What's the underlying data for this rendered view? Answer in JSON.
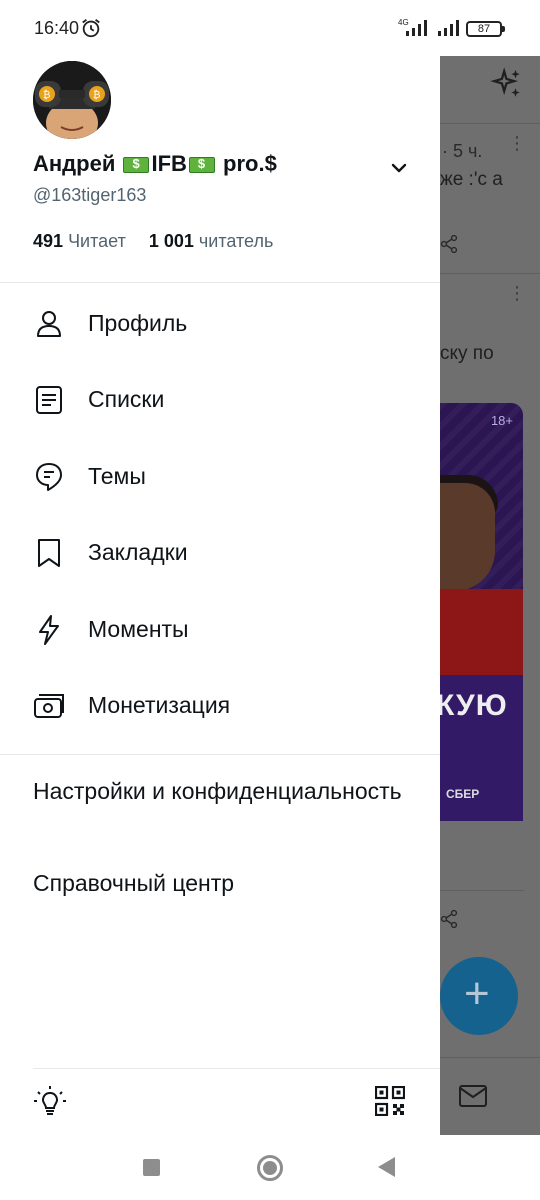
{
  "status_bar": {
    "time": "16:40",
    "network": "4G",
    "battery": "87"
  },
  "profile": {
    "display_name_parts": [
      "Андрей ",
      "IFB",
      " pro.$"
    ],
    "handle": "@163tiger163",
    "following_count": "491",
    "following_label": "Читает",
    "followers_count": "1 001",
    "followers_label": "читатель"
  },
  "menu": {
    "items": [
      {
        "label": "Профиль",
        "icon": "person-icon"
      },
      {
        "label": "Списки",
        "icon": "list-icon"
      },
      {
        "label": "Темы",
        "icon": "topics-icon"
      },
      {
        "label": "Закладки",
        "icon": "bookmark-icon"
      },
      {
        "label": "Моменты",
        "icon": "lightning-icon"
      },
      {
        "label": "Монетизация",
        "icon": "money-icon"
      }
    ],
    "settings_label": "Настройки и конфиденциальность",
    "help_label": "Справочный центр"
  },
  "background_timeline": {
    "tweet1_meta": "· 5 ч.",
    "tweet1_text": "же :'с а",
    "tweet2_text": "ску по",
    "promo_age": "18+",
    "promo_big": "КУЮ",
    "promo_sub": "СБЕР"
  },
  "colors": {
    "primary_text": "#0f1419",
    "secondary_text": "#536471",
    "fab": "#1d9bf0"
  }
}
